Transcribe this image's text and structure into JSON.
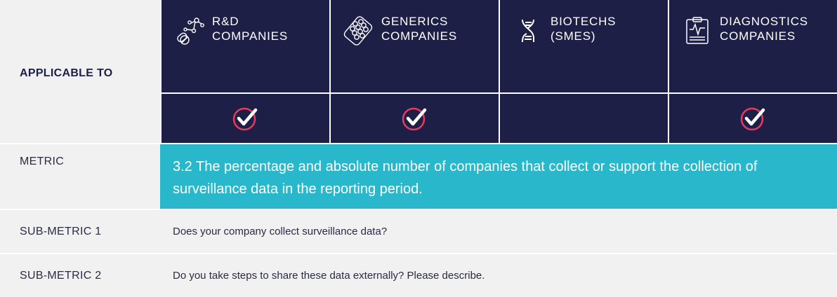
{
  "applicable_to_label": "APPLICABLE TO",
  "columns": [
    {
      "label": "R&D\nCOMPANIES",
      "icon": "molecule-pill-icon",
      "checked": true
    },
    {
      "label": "GENERICS\nCOMPANIES",
      "icon": "pill-blister-icon",
      "checked": true
    },
    {
      "label": "BIOTECHS\n(SMES)",
      "icon": "dna-icon",
      "checked": false
    },
    {
      "label": "DIAGNOSTICS\nCOMPANIES",
      "icon": "clipboard-pulse-icon",
      "checked": true
    }
  ],
  "metric": {
    "label": "METRIC",
    "text": "3.2 The percentage and absolute number of companies that collect or support the collection of surveillance data in the reporting period."
  },
  "sub_metrics": [
    {
      "label": "SUB-METRIC 1",
      "text": "Does your company collect surveillance data?"
    },
    {
      "label": "SUB-METRIC 2",
      "text": "Do you take steps to share these data externally? Please describe."
    }
  ],
  "colors": {
    "navy": "#1e1f47",
    "teal": "#28b7cb",
    "check_pink": "#e83a5f",
    "light_gray": "#f1f1f1"
  }
}
